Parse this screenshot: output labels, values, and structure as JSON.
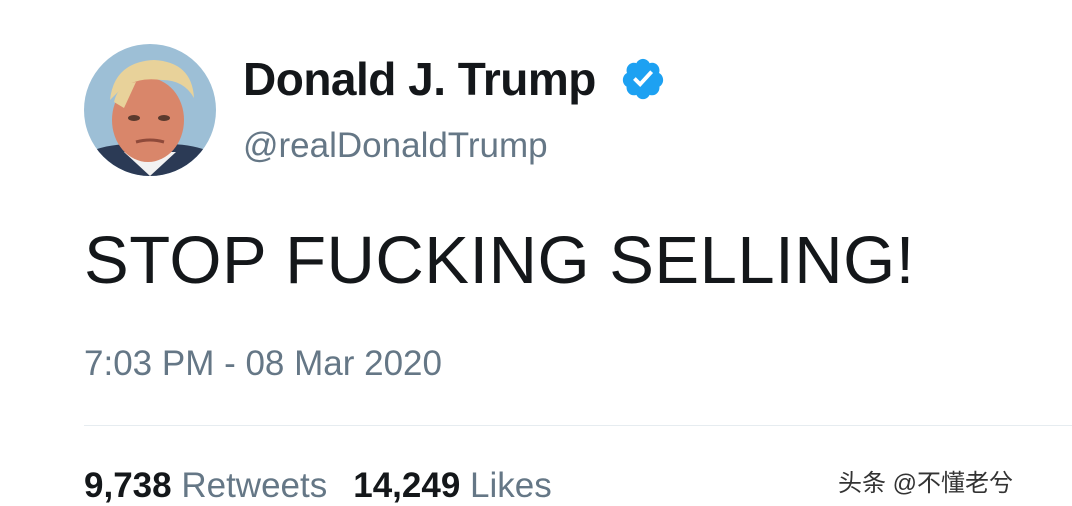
{
  "user": {
    "display_name": "Donald J. Trump",
    "handle": "@realDonaldTrump",
    "verified": true,
    "verified_icon": "verified-badge-icon",
    "verified_color": "#1da1f2"
  },
  "tweet": {
    "text": "STOP FUCKING SELLING!",
    "timestamp": "7:03 PM - 08 Mar 2020"
  },
  "stats": {
    "retweets_count": "9,738",
    "retweets_label": "Retweets",
    "likes_count": "14,249",
    "likes_label": "Likes"
  },
  "watermark": {
    "text": "头条 @不懂老兮"
  },
  "colors": {
    "primary_text": "#14171a",
    "secondary_text": "#657786",
    "divider": "#e6ecf0"
  }
}
